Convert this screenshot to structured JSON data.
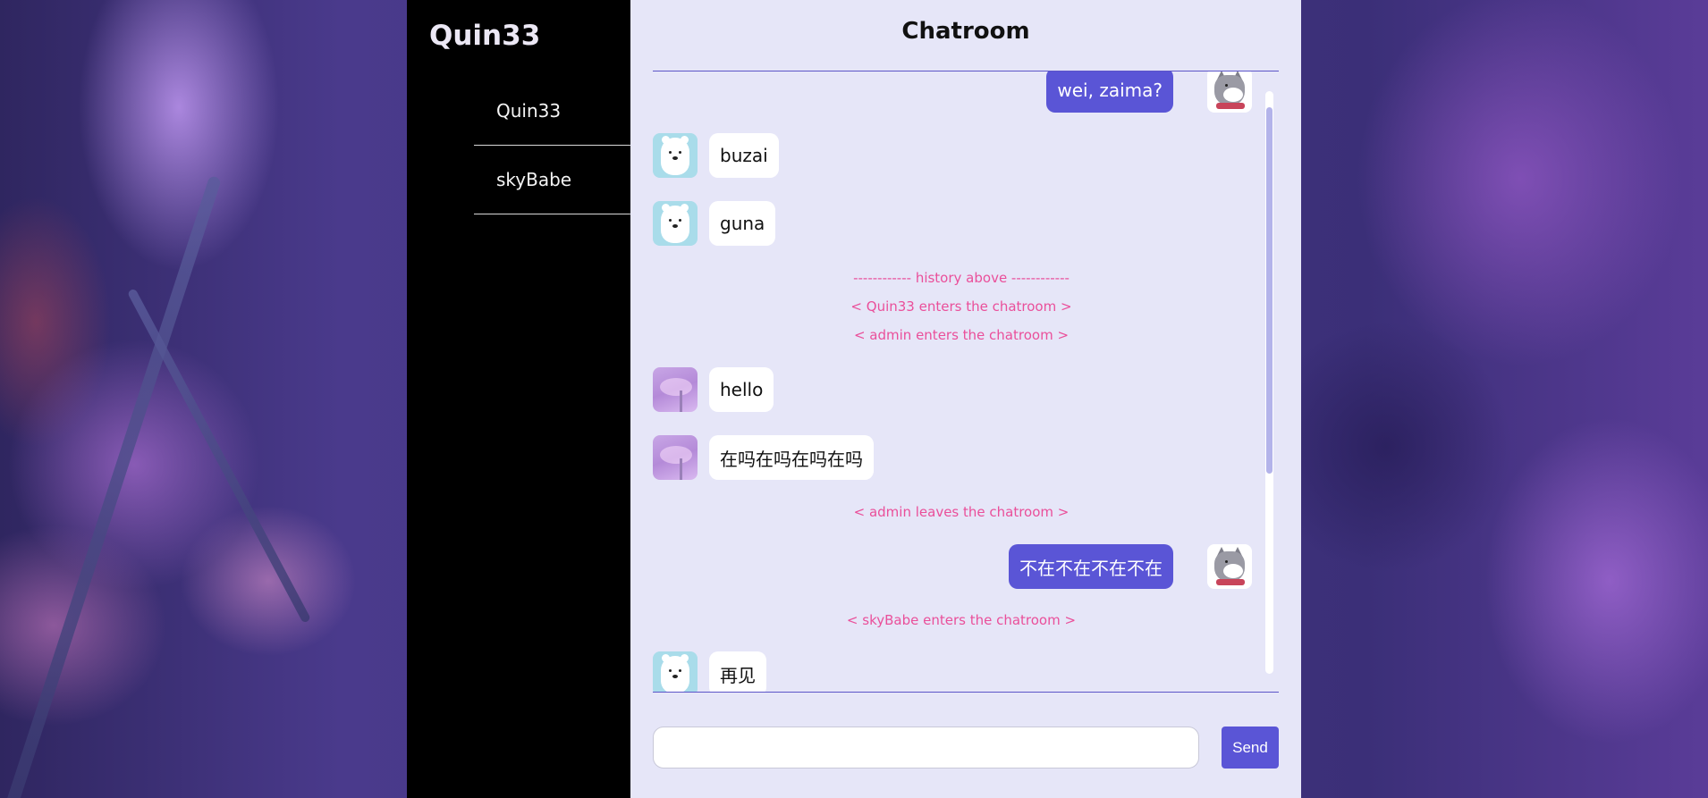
{
  "sidebar": {
    "username": "Quin33",
    "users": [
      "Quin33",
      "skyBabe"
    ]
  },
  "chat": {
    "title": "Chatroom",
    "messages": [
      {
        "side": "right",
        "avatar": "husky-avatar",
        "text": "wei, zaima?"
      },
      {
        "side": "left",
        "avatar": "polar-bear-avatar",
        "text": "buzai"
      },
      {
        "side": "left",
        "avatar": "polar-bear-avatar",
        "text": "guna"
      },
      {
        "notice": "------------ history above ------------"
      },
      {
        "notice": "< Quin33 enters the chatroom >"
      },
      {
        "notice": "< admin enters the chatroom >"
      },
      {
        "side": "left",
        "avatar": "purple-sky-avatar",
        "text": "hello"
      },
      {
        "side": "left",
        "avatar": "purple-sky-avatar",
        "text": "在吗在吗在吗在吗"
      },
      {
        "notice": "< admin leaves the chatroom >"
      },
      {
        "side": "right",
        "avatar": "husky-avatar",
        "text": "不在不在不在不在"
      },
      {
        "notice": "< skyBabe enters the chatroom >"
      },
      {
        "side": "left",
        "avatar": "polar-bear-avatar",
        "text": "再见"
      }
    ]
  },
  "composer": {
    "input_value": "",
    "send_label": "Send"
  },
  "colors": {
    "accent": "#5a55d6",
    "notice": "#ea4f9a",
    "chat_bg": "#e6e6f8",
    "sidebar_bg": "#000000"
  }
}
